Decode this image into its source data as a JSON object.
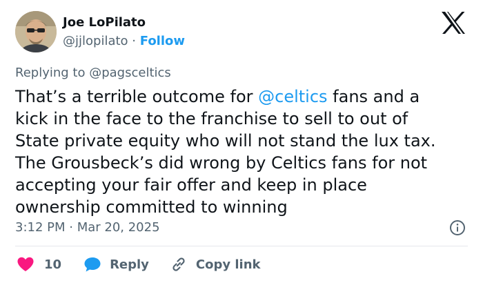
{
  "author": {
    "name": "Joe LoPilato",
    "handle": "@jjlopilato",
    "separator": "·",
    "follow_label": "Follow"
  },
  "reply_context": {
    "prefix": "Replying to",
    "handle": "@pagsceltics"
  },
  "tweet": {
    "lines": [
      {
        "before": "That’s a terrible outcome for ",
        "mention": "@celtics",
        "after": " fans and a"
      },
      {
        "text": "kick in the face to the franchise to sell to out of"
      },
      {
        "text": "State private equity who will not stand the lux tax."
      },
      {
        "text": "The Grousbeck’s did wrong by Celtics fans for not"
      },
      {
        "text": "accepting your fair offer and keep in place"
      },
      {
        "text": "ownership committed to winning"
      }
    ]
  },
  "timestamp": "3:12 PM · Mar 20, 2025",
  "actions": {
    "like_count": "10",
    "reply_label": "Reply",
    "copy_link_label": "Copy link"
  },
  "colors": {
    "accent": "#1d9bf0",
    "like": "#f91880",
    "text": "#0f1419",
    "secondary": "#536471"
  },
  "icons": {
    "platform_logo": "x-logo-icon",
    "info": "info-icon",
    "like": "heart-icon",
    "reply": "speech-bubble-icon",
    "copy_link": "link-icon"
  }
}
